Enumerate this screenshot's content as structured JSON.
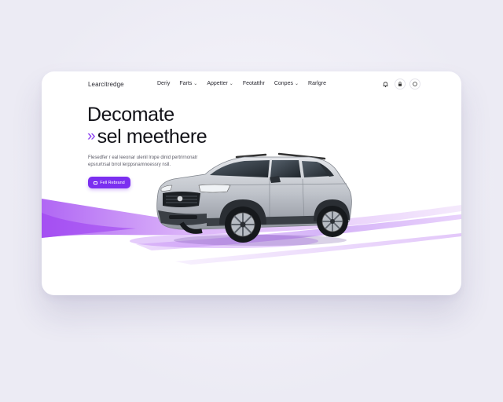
{
  "nav": {
    "brand": "Learcitredge",
    "items": [
      {
        "label": "Deriy",
        "has_dropdown": false
      },
      {
        "label": "Farts",
        "has_dropdown": true
      },
      {
        "label": "Appetter",
        "has_dropdown": true
      },
      {
        "label": "Feotatthr",
        "has_dropdown": false
      },
      {
        "label": "Conpes",
        "has_dropdown": true
      },
      {
        "label": "Rarlgre",
        "has_dropdown": false
      }
    ],
    "icons": [
      "bell-icon",
      "lock-icon",
      "search-icon"
    ],
    "chevron": "⌄"
  },
  "hero": {
    "title_line1": "Decomate",
    "title_accent": "»",
    "title_line2": "sel meethere",
    "description": "Flesedfer r eal leeonar ulenil lrope dinid pertrirnonatr epsrurtrsal brrol lerppsnamnoessry nsll.",
    "cta_label": "Fell Rebrand"
  },
  "colors": {
    "accent": "#7b2ff0",
    "accent_light": "#c58bf7",
    "text": "#121218",
    "background": "#ecebf4"
  }
}
